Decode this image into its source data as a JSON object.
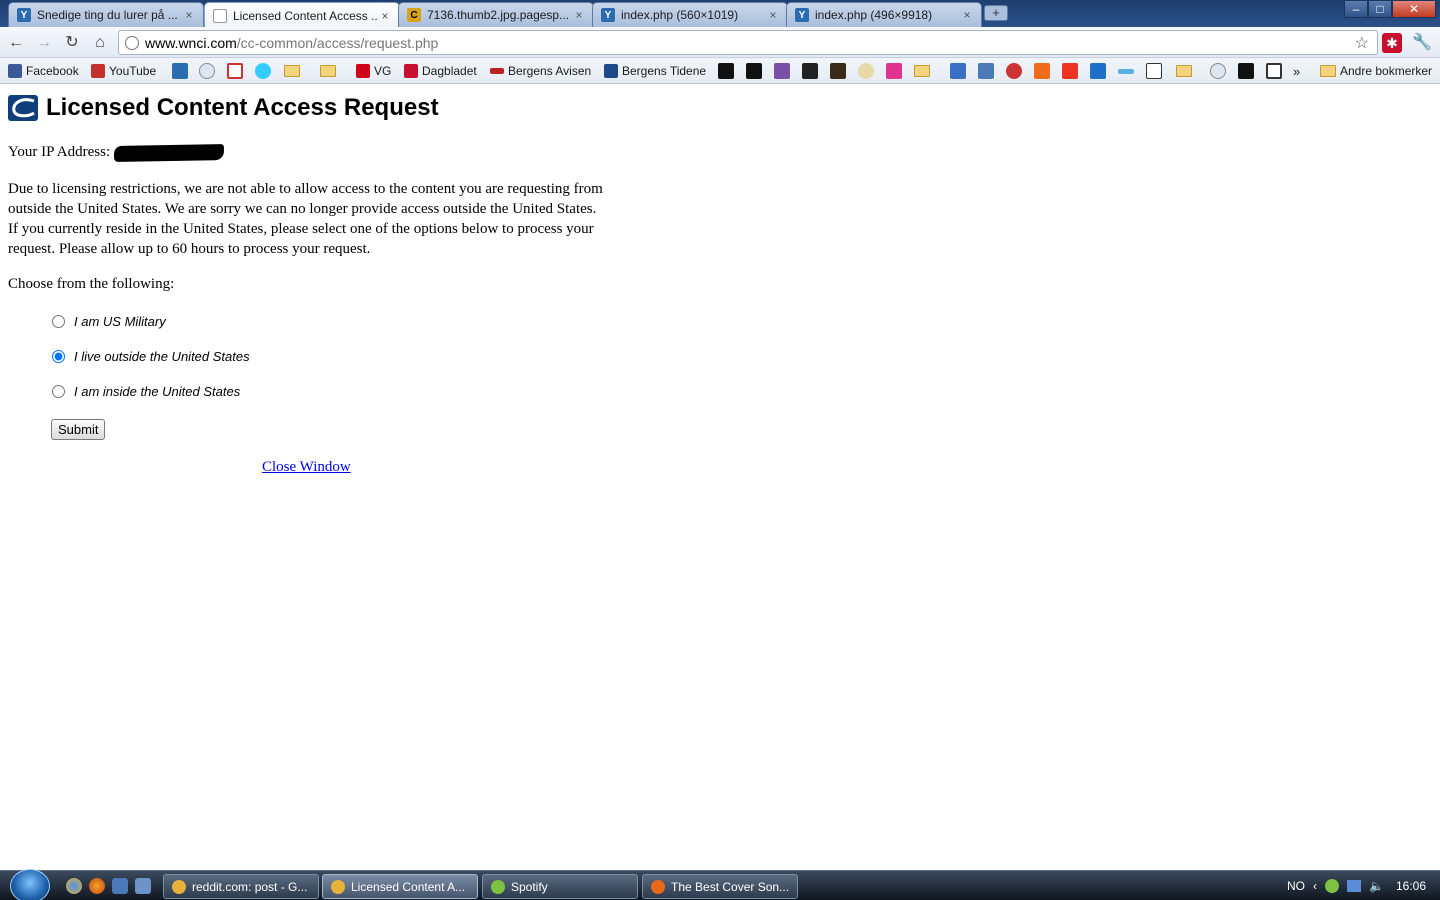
{
  "browser": {
    "tabs": [
      {
        "title": "Snedige ting du lurer på ...",
        "icon": "yr-icon",
        "active": false
      },
      {
        "title": "Licensed Content Access ...",
        "icon": "page-icon",
        "active": true
      },
      {
        "title": "7136.thumb2.jpg.pagesp...",
        "icon": "c-icon",
        "active": false
      },
      {
        "title": "index.php (560×1019)",
        "icon": "yr-icon",
        "active": false
      },
      {
        "title": "index.php (496×9918)",
        "icon": "yr-icon",
        "active": false
      }
    ],
    "tab_close_glyph": "×",
    "new_tab_glyph": "+",
    "window_buttons": {
      "minimize": "–",
      "maximize": "□",
      "close": "✕"
    },
    "address": {
      "host": "www.wnci.com",
      "path": "/cc-common/access/request.php"
    },
    "bookmarks": [
      {
        "label": "Facebook"
      },
      {
        "label": "YouTube"
      },
      {
        "label": "VG"
      },
      {
        "label": "Dagbladet"
      },
      {
        "label": "Bergens Avisen"
      },
      {
        "label": "Bergens Tidene"
      },
      {
        "label": "Andre bokmerker"
      }
    ],
    "bookmarks_overflow": "»"
  },
  "page": {
    "heading": "Licensed Content Access Request",
    "ip_label": "Your IP Address:",
    "intro": "Due to licensing restrictions, we are not able to allow access to the content you are requesting from outside the United States. We are sorry we can no longer provide access outside the United States. If you currently reside in the United States, please select one of the options below to process your request. Please allow up to 60 hours to process your request.",
    "choose_label": "Choose from the following:",
    "options": [
      {
        "label": "I am US Military",
        "checked": false
      },
      {
        "label": "I live outside the United States",
        "checked": true
      },
      {
        "label": "I am inside the United States",
        "checked": false
      }
    ],
    "submit_label": "Submit",
    "close_link": "Close Window"
  },
  "taskbar": {
    "tasks": [
      {
        "label": "reddit.com: post - G...",
        "icon_color": "#e8b13a"
      },
      {
        "label": "Licensed Content A...",
        "icon_color": "#e8b13a"
      },
      {
        "label": "Spotify",
        "icon_color": "#7dc242"
      },
      {
        "label": "The Best Cover Son...",
        "icon_color": "#e66a1a"
      }
    ],
    "language": "NO",
    "clock": "16:06"
  }
}
